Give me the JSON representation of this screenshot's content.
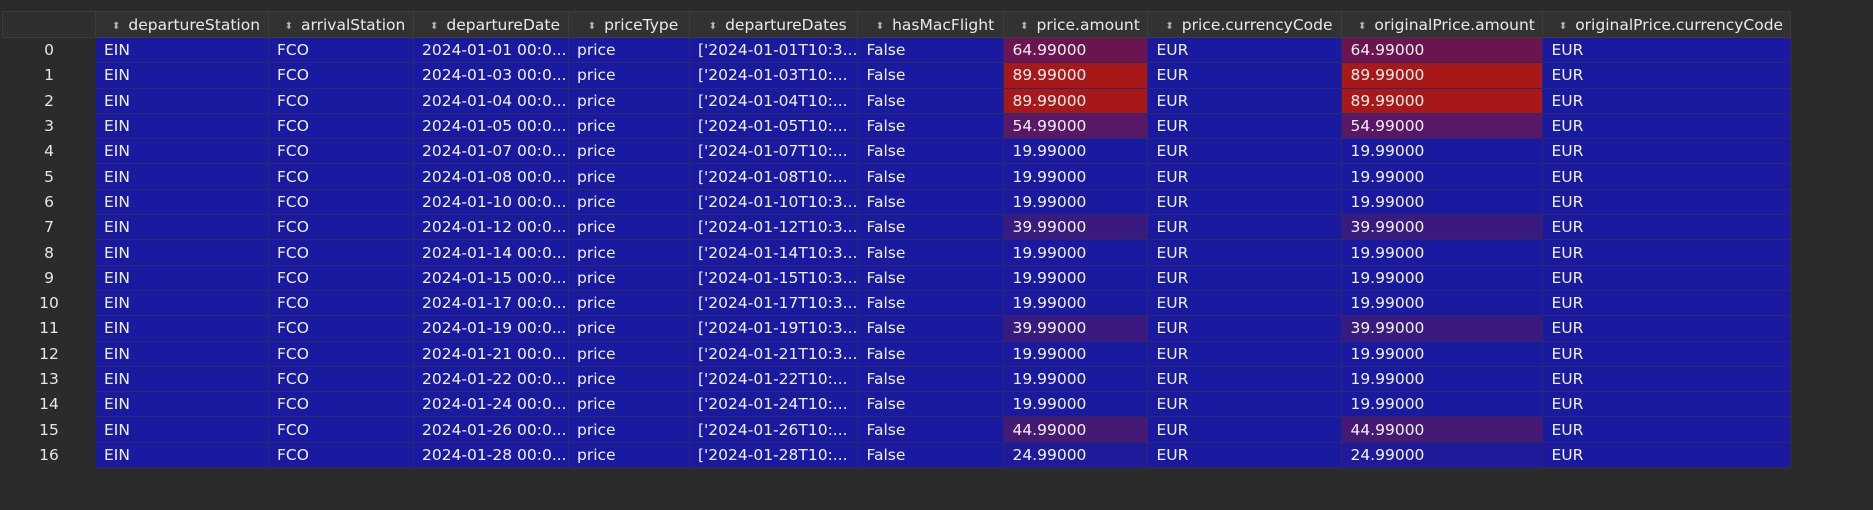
{
  "table": {
    "columns": [
      "departureStation",
      "arrivalStation",
      "departureDate",
      "priceType",
      "departureDates",
      "hasMacFlight",
      "price.amount",
      "price.currencyCode",
      "originalPrice.amount",
      "originalPrice.currencyCode"
    ],
    "heat_colors": {
      "low": "#1a1aa0",
      "purple": "#54166a",
      "red": "#a51a1a",
      "index_bg": "#2b2b2b",
      "header_bg": "#323232"
    },
    "rows": [
      {
        "index": "0",
        "cells": [
          "EIN",
          "FCO",
          "2024-01-01 00:0...",
          "price",
          "['2024-01-01T10:3...",
          "False",
          "64.99000",
          "EUR",
          "64.99000",
          "EUR"
        ],
        "heat": "#6a1550"
      },
      {
        "index": "1",
        "cells": [
          "EIN",
          "FCO",
          "2024-01-03 00:0...",
          "price",
          "['2024-01-03T10:...",
          "False",
          "89.99000",
          "EUR",
          "89.99000",
          "EUR"
        ],
        "heat": "#a81818"
      },
      {
        "index": "2",
        "cells": [
          "EIN",
          "FCO",
          "2024-01-04 00:0...",
          "price",
          "['2024-01-04T10:...",
          "False",
          "89.99000",
          "EUR",
          "89.99000",
          "EUR"
        ],
        "heat": "#a81818"
      },
      {
        "index": "3",
        "cells": [
          "EIN",
          "FCO",
          "2024-01-05 00:0...",
          "price",
          "['2024-01-05T10:...",
          "False",
          "54.99000",
          "EUR",
          "54.99000",
          "EUR"
        ],
        "heat": "#581866"
      },
      {
        "index": "4",
        "cells": [
          "EIN",
          "FCO",
          "2024-01-07 00:0...",
          "price",
          "['2024-01-07T10:...",
          "False",
          "19.99000",
          "EUR",
          "19.99000",
          "EUR"
        ],
        "heat": "#1a1aa0"
      },
      {
        "index": "5",
        "cells": [
          "EIN",
          "FCO",
          "2024-01-08 00:0...",
          "price",
          "['2024-01-08T10:...",
          "False",
          "19.99000",
          "EUR",
          "19.99000",
          "EUR"
        ],
        "heat": "#1a1aa0"
      },
      {
        "index": "6",
        "cells": [
          "EIN",
          "FCO",
          "2024-01-10 00:0...",
          "price",
          "['2024-01-10T10:3...",
          "False",
          "19.99000",
          "EUR",
          "19.99000",
          "EUR"
        ],
        "heat": "#1a1aa0"
      },
      {
        "index": "7",
        "cells": [
          "EIN",
          "FCO",
          "2024-01-12 00:0...",
          "price",
          "['2024-01-12T10:3...",
          "False",
          "39.99000",
          "EUR",
          "39.99000",
          "EUR"
        ],
        "heat": "#3a1a7e"
      },
      {
        "index": "8",
        "cells": [
          "EIN",
          "FCO",
          "2024-01-14 00:0...",
          "price",
          "['2024-01-14T10:3...",
          "False",
          "19.99000",
          "EUR",
          "19.99000",
          "EUR"
        ],
        "heat": "#1a1aa0"
      },
      {
        "index": "9",
        "cells": [
          "EIN",
          "FCO",
          "2024-01-15 00:0...",
          "price",
          "['2024-01-15T10:3...",
          "False",
          "19.99000",
          "EUR",
          "19.99000",
          "EUR"
        ],
        "heat": "#1a1aa0"
      },
      {
        "index": "10",
        "cells": [
          "EIN",
          "FCO",
          "2024-01-17 00:0...",
          "price",
          "['2024-01-17T10:3...",
          "False",
          "19.99000",
          "EUR",
          "19.99000",
          "EUR"
        ],
        "heat": "#1a1aa0"
      },
      {
        "index": "11",
        "cells": [
          "EIN",
          "FCO",
          "2024-01-19 00:0...",
          "price",
          "['2024-01-19T10:3...",
          "False",
          "39.99000",
          "EUR",
          "39.99000",
          "EUR"
        ],
        "heat": "#3a1a7e"
      },
      {
        "index": "12",
        "cells": [
          "EIN",
          "FCO",
          "2024-01-21 00:0...",
          "price",
          "['2024-01-21T10:3...",
          "False",
          "19.99000",
          "EUR",
          "19.99000",
          "EUR"
        ],
        "heat": "#1a1aa0"
      },
      {
        "index": "13",
        "cells": [
          "EIN",
          "FCO",
          "2024-01-22 00:0...",
          "price",
          "['2024-01-22T10:...",
          "False",
          "19.99000",
          "EUR",
          "19.99000",
          "EUR"
        ],
        "heat": "#1a1aa0"
      },
      {
        "index": "14",
        "cells": [
          "EIN",
          "FCO",
          "2024-01-24 00:0...",
          "price",
          "['2024-01-24T10:...",
          "False",
          "19.99000",
          "EUR",
          "19.99000",
          "EUR"
        ],
        "heat": "#1a1aa0"
      },
      {
        "index": "15",
        "cells": [
          "EIN",
          "FCO",
          "2024-01-26 00:0...",
          "price",
          "['2024-01-26T10:...",
          "False",
          "44.99000",
          "EUR",
          "44.99000",
          "EUR"
        ],
        "heat": "#461a74"
      },
      {
        "index": "16",
        "cells": [
          "EIN",
          "FCO",
          "2024-01-28 00:0...",
          "price",
          "['2024-01-28T10:...",
          "False",
          "24.99000",
          "EUR",
          "24.99000",
          "EUR"
        ],
        "heat": "#1e1a9a"
      }
    ]
  }
}
